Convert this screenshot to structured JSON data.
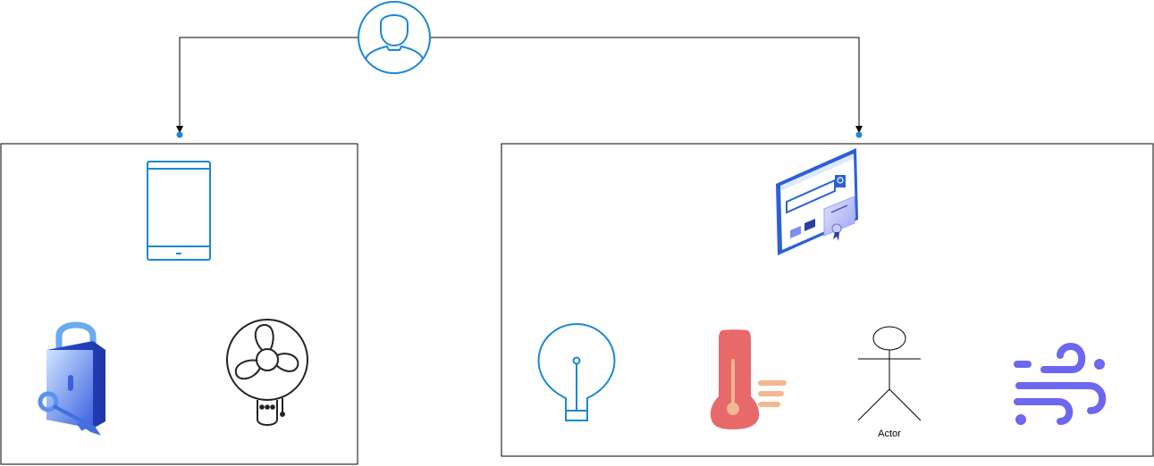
{
  "diagram": {
    "colors": {
      "line": "#000000",
      "accent_blue": "#1b87d6",
      "endpoint_dot": "#1b87d6",
      "container_border": "#000000",
      "thermo_red": "#e8696a",
      "thermo_peach": "#f3b890",
      "wind_purple": "#6b67f0",
      "lock_blue": "#3f6fe0"
    },
    "nodes": {
      "user": {
        "icon": "user-circle-icon"
      },
      "left_group": {
        "items": [
          {
            "icon": "tablet-icon"
          },
          {
            "icon": "padlock-key-icon"
          },
          {
            "icon": "fan-icon"
          }
        ]
      },
      "right_group": {
        "items": [
          {
            "icon": "web-certificate-icon"
          },
          {
            "icon": "lightbulb-icon"
          },
          {
            "icon": "thermometer-icon"
          },
          {
            "icon": "actor-icon",
            "label": "Actor"
          },
          {
            "icon": "wind-icon"
          }
        ]
      }
    },
    "edges": [
      {
        "from": "user",
        "to": "left_group"
      },
      {
        "from": "user",
        "to": "right_group"
      }
    ]
  }
}
